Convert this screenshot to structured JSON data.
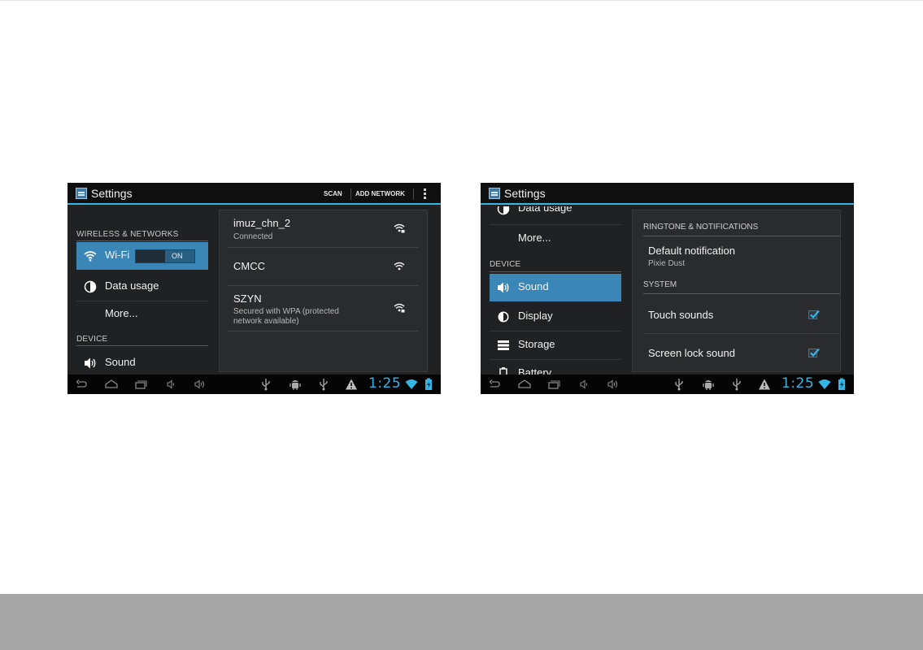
{
  "left_screen": {
    "app_title": "Settings",
    "actions": {
      "scan": "SCAN",
      "add_network": "ADD NETWORK"
    },
    "headers": {
      "wireless": "WIRELESS & NETWORKS",
      "device": "DEVICE"
    },
    "items": {
      "wifi": "Wi-Fi",
      "data_usage": "Data usage",
      "more": "More...",
      "sound": "Sound"
    },
    "wifi_toggle": "ON",
    "networks": [
      {
        "name": "imuz_chn_2",
        "status": "Connected"
      },
      {
        "name": "CMCC",
        "status": ""
      },
      {
        "name": "SZYN",
        "status": "Secured with WPA (protected network available)"
      }
    ],
    "clock": "1:25"
  },
  "right_screen": {
    "app_title": "Settings",
    "items": {
      "data_usage": "Data usage",
      "more": "More...",
      "sound": "Sound",
      "display": "Display",
      "storage": "Storage",
      "battery": "Battery"
    },
    "headers": {
      "device": "DEVICE"
    },
    "sections": {
      "ringtone": "RINGTONE & NOTIFICATIONS",
      "system": "SYSTEM"
    },
    "default_notification": {
      "title": "Default notification",
      "value": "Pixie Dust"
    },
    "touch_sounds": {
      "label": "Touch sounds",
      "checked": true
    },
    "screen_lock_sound": {
      "label": "Screen lock sound",
      "checked": true
    },
    "clock": "1:25"
  },
  "colors": {
    "accent": "#33b5e5",
    "selected": "#3a86b6",
    "footer": "#a7a6a6"
  }
}
